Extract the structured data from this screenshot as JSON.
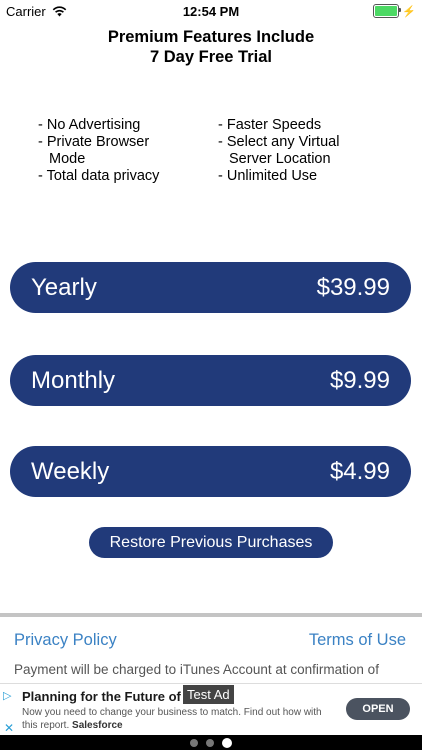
{
  "status": {
    "carrier": "Carrier",
    "time": "12:54 PM"
  },
  "title": {
    "line1": "Premium Features Include",
    "line2": "7 Day Free Trial"
  },
  "features": {
    "left": [
      "- No Advertising",
      "- Private Browser",
      "Mode",
      "- Total data privacy"
    ],
    "right": [
      "- Faster Speeds",
      "- Select any Virtual",
      "Server Location",
      "- Unlimited Use"
    ]
  },
  "plans": [
    {
      "name": "Yearly",
      "price": "$39.99"
    },
    {
      "name": "Monthly",
      "price": "$9.99"
    },
    {
      "name": "Weekly",
      "price": "$4.99"
    }
  ],
  "restore_label": "Restore Previous Purchases",
  "links": {
    "privacy": "Privacy Policy",
    "terms": "Terms of Use"
  },
  "payment_text": "Payment will be charged to iTunes Account at confirmation of",
  "ad": {
    "title": "Planning for the Future of A",
    "tag": "Test Ad",
    "sub1": "Now you need to change your business to match. Find out how with",
    "sub2": "this report.",
    "brand": "Salesforce",
    "cta": "OPEN"
  },
  "colors": {
    "button": "#213a7a",
    "link": "#3b82c4"
  }
}
